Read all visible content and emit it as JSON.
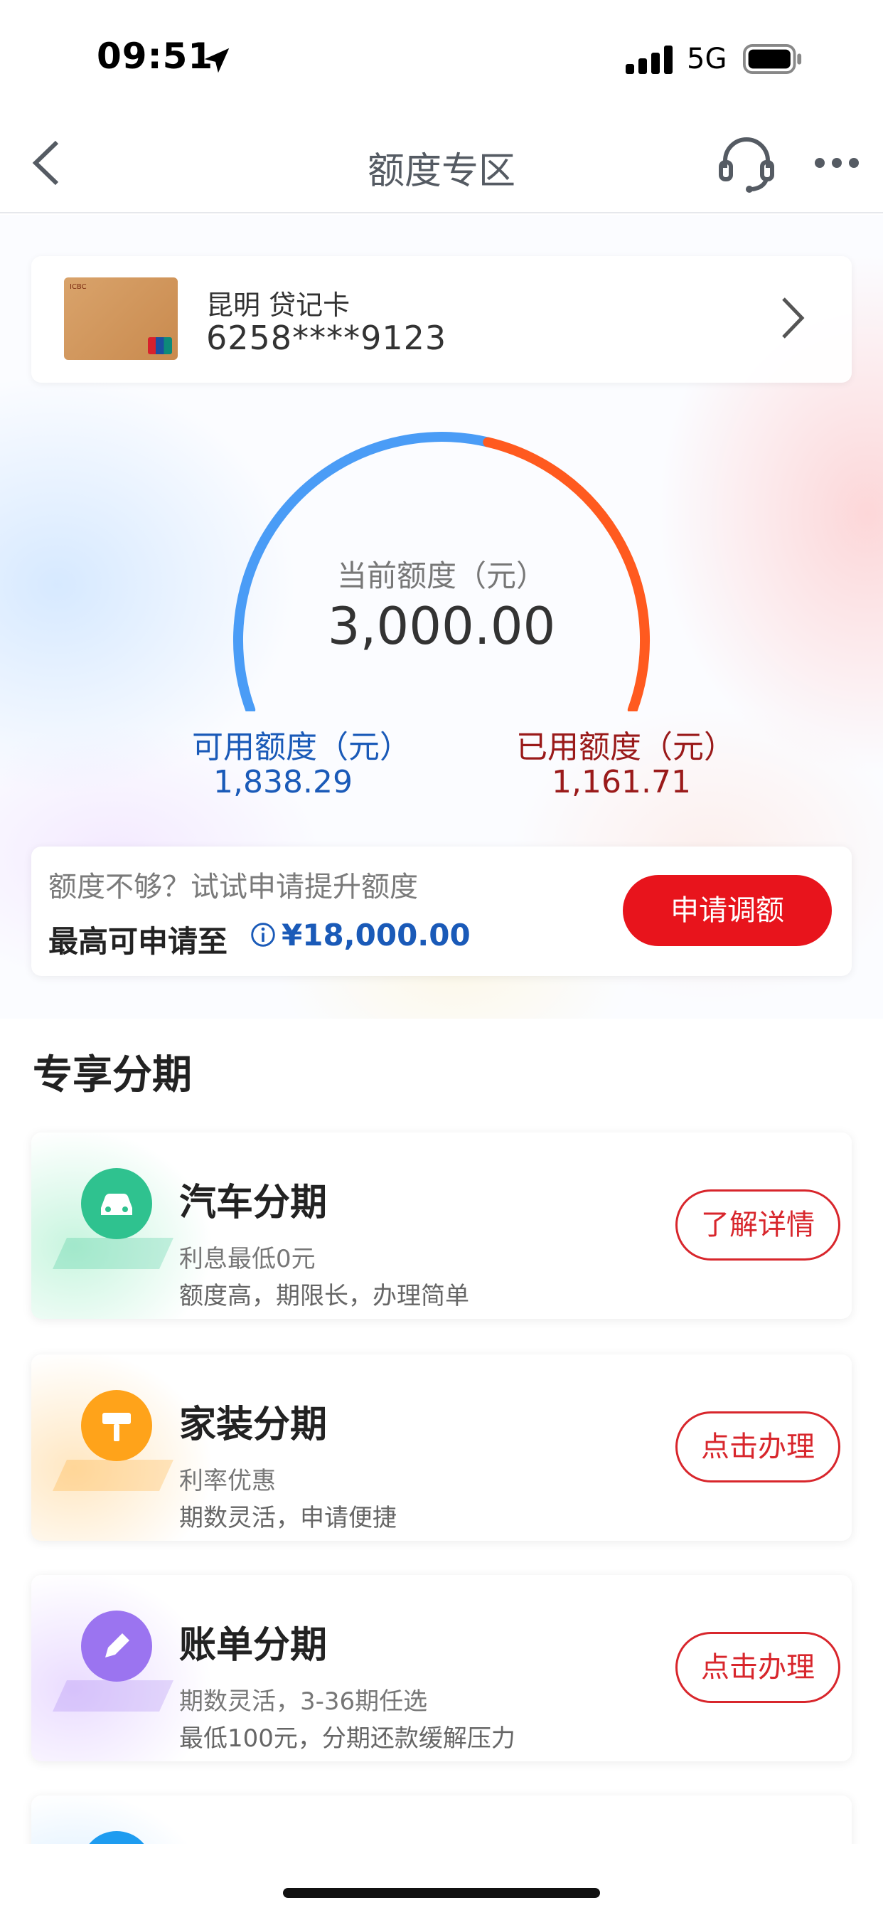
{
  "status_bar": {
    "time": "09:51",
    "network": "5G"
  },
  "nav": {
    "title": "额度专区",
    "back_icon": "chevron-left-icon",
    "service_icon": "headset-icon",
    "more_icon": "more-dots-icon"
  },
  "card": {
    "name": "昆明 贷记卡",
    "number": "6258****9123"
  },
  "gauge": {
    "label": "当前额度（元）",
    "total": "3,000.00",
    "available_label": "可用额度（元）",
    "available": "1,838.29",
    "used_label": "已用额度（元）",
    "used": "1,161.71",
    "available_fraction": 0.6128,
    "colors": {
      "available": "#4a9cf6",
      "used": "#ff5a1f"
    }
  },
  "raise": {
    "hint": "额度不够？试试申请提升额度",
    "max_label": "最高可申请至",
    "max_value": "¥18,000.00",
    "button": "申请调额"
  },
  "section": {
    "title": "专享分期"
  },
  "installments": [
    {
      "title": "汽车分期",
      "line1": "利息最低0元",
      "line2": "额度高，期限长，办理简单",
      "button": "了解详情",
      "icon": "car-icon",
      "color": "#2fc28f",
      "glow": "#c8f5df"
    },
    {
      "title": "家装分期",
      "line1": "利率优惠",
      "line2": "期数灵活，申请便捷",
      "button": "点击办理",
      "icon": "paint-roller-icon",
      "color": "#ffa31a",
      "glow": "#ffe7c2"
    },
    {
      "title": "账单分期",
      "line1": "期数灵活，3-36期任选",
      "line2": "最低100元，分期还款缓解压力",
      "button": "点击办理",
      "icon": "pencil-icon",
      "color": "#9b74f0",
      "glow": "#eadcff"
    },
    {
      "title": "",
      "line1": "",
      "line2": "",
      "button": "",
      "icon": "wallet-icon",
      "color": "#1e9cf0",
      "glow": "#d4ebff"
    }
  ]
}
